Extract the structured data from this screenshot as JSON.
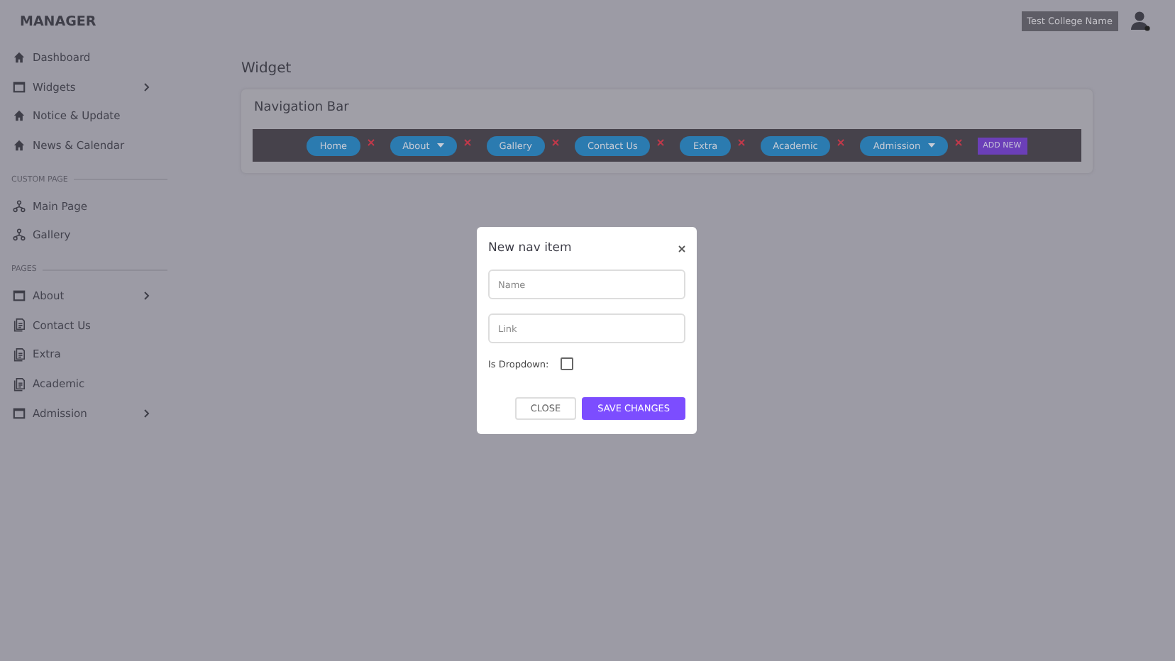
{
  "brand": "MANAGER",
  "header": {
    "college": "Test College Name"
  },
  "sidebar": {
    "sections": [
      {
        "items": [
          {
            "label": "Dashboard",
            "kind": "home",
            "expandable": false
          },
          {
            "label": "Widgets",
            "kind": "window",
            "expandable": true
          },
          {
            "label": "Notice & Update",
            "kind": "home",
            "expandable": false
          },
          {
            "label": "News & Calendar",
            "kind": "home",
            "expandable": false
          }
        ]
      },
      {
        "heading": "CUSTOM PAGE",
        "items": [
          {
            "label": "Main Page",
            "kind": "flow",
            "expandable": false
          },
          {
            "label": "Gallery",
            "kind": "flow",
            "expandable": false
          }
        ]
      },
      {
        "heading": "PAGES",
        "items": [
          {
            "label": "About",
            "kind": "window",
            "expandable": true
          },
          {
            "label": "Contact Us",
            "kind": "doc",
            "expandable": false
          },
          {
            "label": "Extra",
            "kind": "doc",
            "expandable": false
          },
          {
            "label": "Academic",
            "kind": "doc",
            "expandable": false
          },
          {
            "label": "Admission",
            "kind": "window",
            "expandable": true
          }
        ]
      }
    ]
  },
  "page_title": "Widget",
  "card": {
    "title": "Navigation Bar",
    "nav_items": [
      {
        "label": "Home",
        "dropdown": false
      },
      {
        "label": "About",
        "dropdown": true
      },
      {
        "label": "Gallery",
        "dropdown": false
      },
      {
        "label": "Contact Us",
        "dropdown": false
      },
      {
        "label": "Extra",
        "dropdown": false
      },
      {
        "label": "Academic",
        "dropdown": false
      },
      {
        "label": "Admission",
        "dropdown": true
      }
    ],
    "add_button": "ADD NEW"
  },
  "modal": {
    "title": "New nav item",
    "fields": [
      {
        "placeholder": "Name"
      },
      {
        "placeholder": "Link"
      }
    ],
    "dropdown_label": "Is Dropdown:",
    "dropdown_checked": false,
    "buttons": {
      "close": "CLOSE",
      "save": "SAVE CHANGES"
    }
  }
}
